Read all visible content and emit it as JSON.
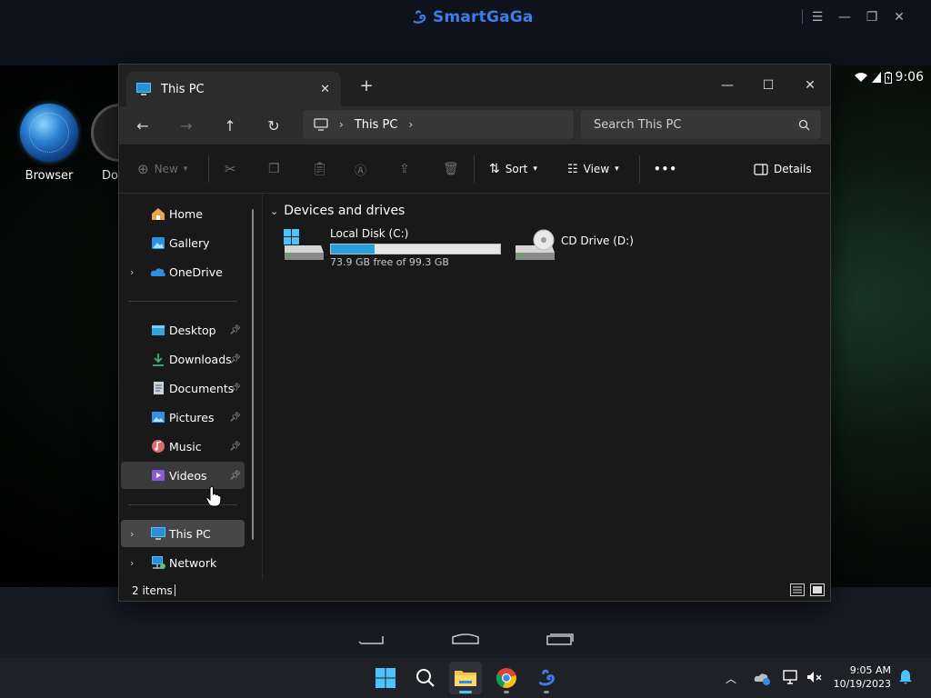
{
  "emulator": {
    "brand": "SmartGaGa",
    "controls": [
      "menu-icon",
      "minimize-icon",
      "restore-icon",
      "close-icon"
    ]
  },
  "android": {
    "status_time": "9:06",
    "desktop_icons": [
      {
        "label": "Browser",
        "icon": "globe-icon"
      },
      {
        "label": "Do",
        "icon": "app-icon"
      }
    ],
    "nav": [
      "back-icon",
      "home-icon",
      "recents-icon"
    ]
  },
  "explorer": {
    "tab_title": "This PC",
    "window_controls": [
      "minimize-icon",
      "maximize-icon",
      "close-icon"
    ],
    "address": {
      "segments": [
        "This PC"
      ]
    },
    "search_placeholder": "Search This PC",
    "commands": {
      "new": "New",
      "sort": "Sort",
      "view": "View",
      "more": "•••",
      "details": "Details"
    },
    "sidebar": {
      "quick": [
        {
          "label": "Home",
          "icon": "home-icon"
        },
        {
          "label": "Gallery",
          "icon": "gallery-icon"
        },
        {
          "label": "OneDrive",
          "icon": "cloud-icon"
        }
      ],
      "pinned": [
        {
          "label": "Desktop",
          "icon": "desktop-icon"
        },
        {
          "label": "Downloads",
          "icon": "download-icon"
        },
        {
          "label": "Documents",
          "icon": "document-icon"
        },
        {
          "label": "Pictures",
          "icon": "picture-icon"
        },
        {
          "label": "Music",
          "icon": "music-icon"
        },
        {
          "label": "Videos",
          "icon": "video-icon"
        }
      ],
      "roots": [
        {
          "label": "This PC",
          "icon": "pc-icon"
        },
        {
          "label": "Network",
          "icon": "network-icon"
        }
      ]
    },
    "group_header": "Devices and drives",
    "drives": [
      {
        "name": "Local Disk (C:)",
        "free_text": "73.9 GB free of 99.3 GB",
        "used_fraction": 0.256
      },
      {
        "name": "CD Drive (D:)"
      }
    ],
    "status": "2 items"
  },
  "taskbar": {
    "apps": [
      "start-icon",
      "search-icon",
      "file-explorer-icon",
      "chrome-icon",
      "smartgaga-icon"
    ],
    "time": "9:05 AM",
    "date": "10/19/2023"
  },
  "colors": {
    "accent": "#4cc2ff",
    "drive_bar": "#26a0da",
    "brand": "#3d7fe6"
  }
}
